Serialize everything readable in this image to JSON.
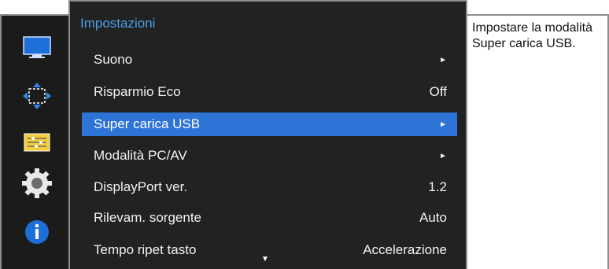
{
  "menu": {
    "title": "Impostazioni",
    "items": [
      {
        "label": "Suono",
        "value": "►",
        "kind": "arrow"
      },
      {
        "label": "Risparmio Eco",
        "value": "Off",
        "kind": "value"
      },
      {
        "label": "Super carica USB",
        "value": "►",
        "kind": "arrow",
        "selected": true
      },
      {
        "label": "Modalità PC/AV",
        "value": "►",
        "kind": "arrow"
      },
      {
        "label": "DisplayPort ver.",
        "value": "1.2",
        "kind": "value"
      },
      {
        "label": "Rilevam. sorgente",
        "value": "Auto",
        "kind": "value"
      },
      {
        "label": "Tempo ripet tasto",
        "value": "Accelerazione",
        "kind": "value"
      }
    ],
    "scroll_down": "▼"
  },
  "help": {
    "text": "Impostare la modalità Super carica USB."
  },
  "sidebar": {
    "icons": [
      "monitor-icon",
      "size-position-icon",
      "settings-sliders-icon",
      "gear-icon",
      "info-icon"
    ]
  },
  "colors": {
    "accent": "#2e74d6",
    "title": "#4a9ee6",
    "panel": "#222222"
  }
}
